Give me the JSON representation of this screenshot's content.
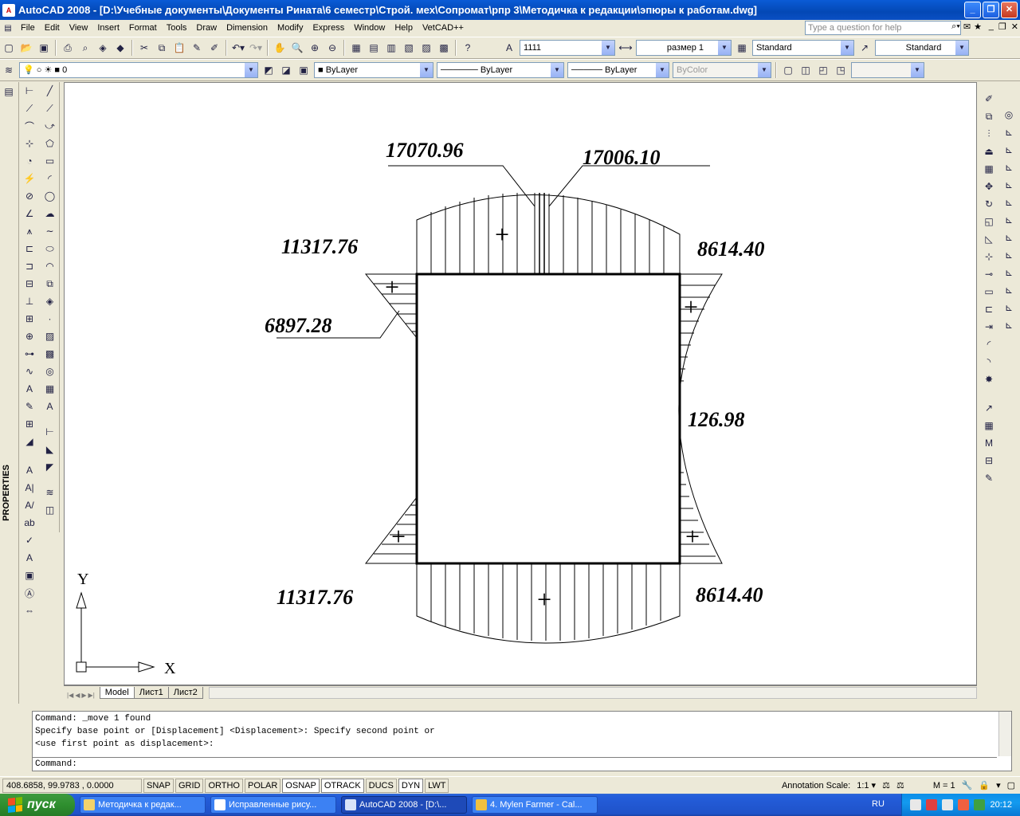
{
  "window": {
    "title": "AutoCAD 2008 - [D:\\Учебные документы\\Документы Рината\\6 семестр\\Строй. мех\\Сопромат\\рпр 3\\Методичка к редакции\\эпюры к работам.dwg]",
    "minimize": "_",
    "maximize": "❐",
    "close": "✕"
  },
  "menu": {
    "items": [
      "File",
      "Edit",
      "View",
      "Insert",
      "Format",
      "Tools",
      "Draw",
      "Dimension",
      "Modify",
      "Express",
      "Window",
      "Help",
      "VetCAD++"
    ],
    "help_placeholder": "Type a question for help"
  },
  "toolbar1": {
    "text_style_value": "1111",
    "dim_style_value": "размер 1",
    "table_style_value": "Standard",
    "mleader_style_value": "Standard"
  },
  "toolbar2": {
    "layer_value": "0",
    "color_value": "ByLayer",
    "linetype_value": "ByLayer",
    "lineweight_value": "ByLayer",
    "plotstyle_value": "ByColor"
  },
  "properties_label": "PROPERTIES",
  "drawing": {
    "labels": {
      "top_left_peak": "17070.96",
      "top_right_peak": "17006.10",
      "top_left": "11317.76",
      "top_right": "8614.40",
      "left_side": "6897.28",
      "right_middle": "126.98",
      "bottom_left": "11317.76",
      "bottom_right": "8614.40"
    },
    "sign": "+",
    "ucs_x": "X",
    "ucs_y": "Y"
  },
  "layout_tabs": [
    "Model",
    "Лист1",
    "Лист2"
  ],
  "command": {
    "lines": [
      "Command: _move 1 found",
      "Specify base point or [Displacement] <Displacement>: Specify second point or",
      "<use first point as displacement>:"
    ],
    "prompt": "Command:"
  },
  "status": {
    "coords": "408.6858, 99.9783 , 0.0000",
    "toggles": [
      "SNAP",
      "GRID",
      "ORTHO",
      "POLAR",
      "OSNAP",
      "OTRACK",
      "DUCS",
      "DYN",
      "LWT"
    ],
    "annotation_scale_label": "Annotation Scale:",
    "annotation_scale_value": "1:1",
    "m_value": "M = 1"
  },
  "taskbar": {
    "start": "пуск",
    "tasks": [
      "Методичка к редак...",
      "Исправленные рису...",
      "AutoCAD 2008 - [D:\\...",
      "4. Mylen Farmer - Cal..."
    ],
    "lang": "RU",
    "clock": "20:12"
  },
  "colors": {
    "titlebar": "#0a5bd6",
    "taskbar": "#245edb",
    "start_button": "#3e9a3e",
    "canvas": "#ffffff"
  }
}
